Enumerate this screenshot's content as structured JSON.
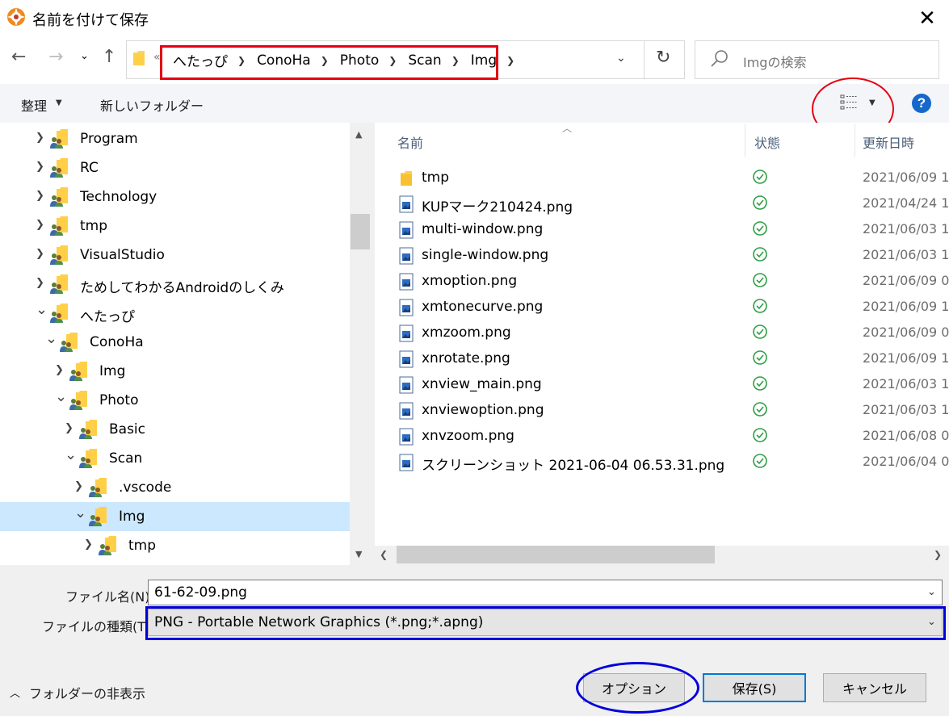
{
  "window": {
    "title": "名前を付けて保存",
    "close": "✕"
  },
  "nav": {
    "back": "←",
    "forward": "→",
    "recent": "⌄",
    "up": "↑",
    "address_overflow": "«",
    "breadcrumbs": [
      "へたっぴ",
      "ConoHa",
      "Photo",
      "Scan",
      "Img"
    ],
    "refresh": "↻",
    "dropdown": "⌄",
    "search_placeholder": "Imgの検索"
  },
  "toolbar": {
    "organize": "整理",
    "new_folder": "新しいフォルダー",
    "help": "?"
  },
  "tree": {
    "items": [
      {
        "label": "Program",
        "level": 0,
        "expanded": false,
        "selected": false
      },
      {
        "label": "RC",
        "level": 0,
        "expanded": false,
        "selected": false
      },
      {
        "label": "Technology",
        "level": 0,
        "expanded": false,
        "selected": false
      },
      {
        "label": "tmp",
        "level": 0,
        "expanded": false,
        "selected": false
      },
      {
        "label": "VisualStudio",
        "level": 0,
        "expanded": false,
        "selected": false
      },
      {
        "label": "ためしてわかるAndroidのしくみ",
        "level": 0,
        "expanded": false,
        "selected": false
      },
      {
        "label": "へたっぴ",
        "level": 0,
        "expanded": true,
        "selected": false
      },
      {
        "label": "ConoHa",
        "level": 1,
        "expanded": true,
        "selected": false
      },
      {
        "label": "Img",
        "level": 2,
        "expanded": false,
        "selected": false
      },
      {
        "label": "Photo",
        "level": 2,
        "expanded": true,
        "selected": false
      },
      {
        "label": "Basic",
        "level": 3,
        "expanded": false,
        "selected": false
      },
      {
        "label": "Scan",
        "level": 3,
        "expanded": true,
        "selected": false
      },
      {
        "label": ".vscode",
        "level": 4,
        "expanded": false,
        "selected": false
      },
      {
        "label": "Img",
        "level": 4,
        "expanded": true,
        "selected": true
      },
      {
        "label": "tmp",
        "level": 5,
        "expanded": false,
        "selected": false
      }
    ]
  },
  "list": {
    "columns": {
      "name": "名前",
      "status": "状態",
      "modified": "更新日時"
    },
    "files": [
      {
        "name": "tmp",
        "type": "folder",
        "date": "2021/06/09 1"
      },
      {
        "name": "KUPマーク210424.png",
        "type": "image",
        "date": "2021/04/24 1"
      },
      {
        "name": "multi-window.png",
        "type": "image",
        "date": "2021/06/03 1"
      },
      {
        "name": "single-window.png",
        "type": "image",
        "date": "2021/06/03 1"
      },
      {
        "name": "xmoption.png",
        "type": "image",
        "date": "2021/06/09 0"
      },
      {
        "name": "xmtonecurve.png",
        "type": "image",
        "date": "2021/06/09 1"
      },
      {
        "name": "xmzoom.png",
        "type": "image",
        "date": "2021/06/09 0"
      },
      {
        "name": "xnrotate.png",
        "type": "image",
        "date": "2021/06/09 1"
      },
      {
        "name": "xnview_main.png",
        "type": "image",
        "date": "2021/06/03 1"
      },
      {
        "name": "xnviewoption.png",
        "type": "image",
        "date": "2021/06/03 1"
      },
      {
        "name": "xnvzoom.png",
        "type": "image",
        "date": "2021/06/08 0"
      },
      {
        "name": "スクリーンショット 2021-06-04 06.53.31.png",
        "type": "image",
        "date": "2021/06/04 0"
      }
    ]
  },
  "bottom": {
    "filename_label": "ファイル名(N):",
    "filename_value": "61-62-09.png",
    "filetype_label": "ファイルの種類(T):",
    "filetype_value": "PNG - Portable Network Graphics (*.png;*.apng)",
    "hide_folders": "フォルダーの非表示",
    "options": "オプション",
    "save": "保存(S)",
    "cancel": "キャンセル"
  },
  "colors": {
    "accent_red": "#e60012",
    "accent_blue": "#0000dd",
    "selection": "#cce8ff",
    "status_ok": "#2e9e44",
    "help_blue": "#1468cc"
  }
}
